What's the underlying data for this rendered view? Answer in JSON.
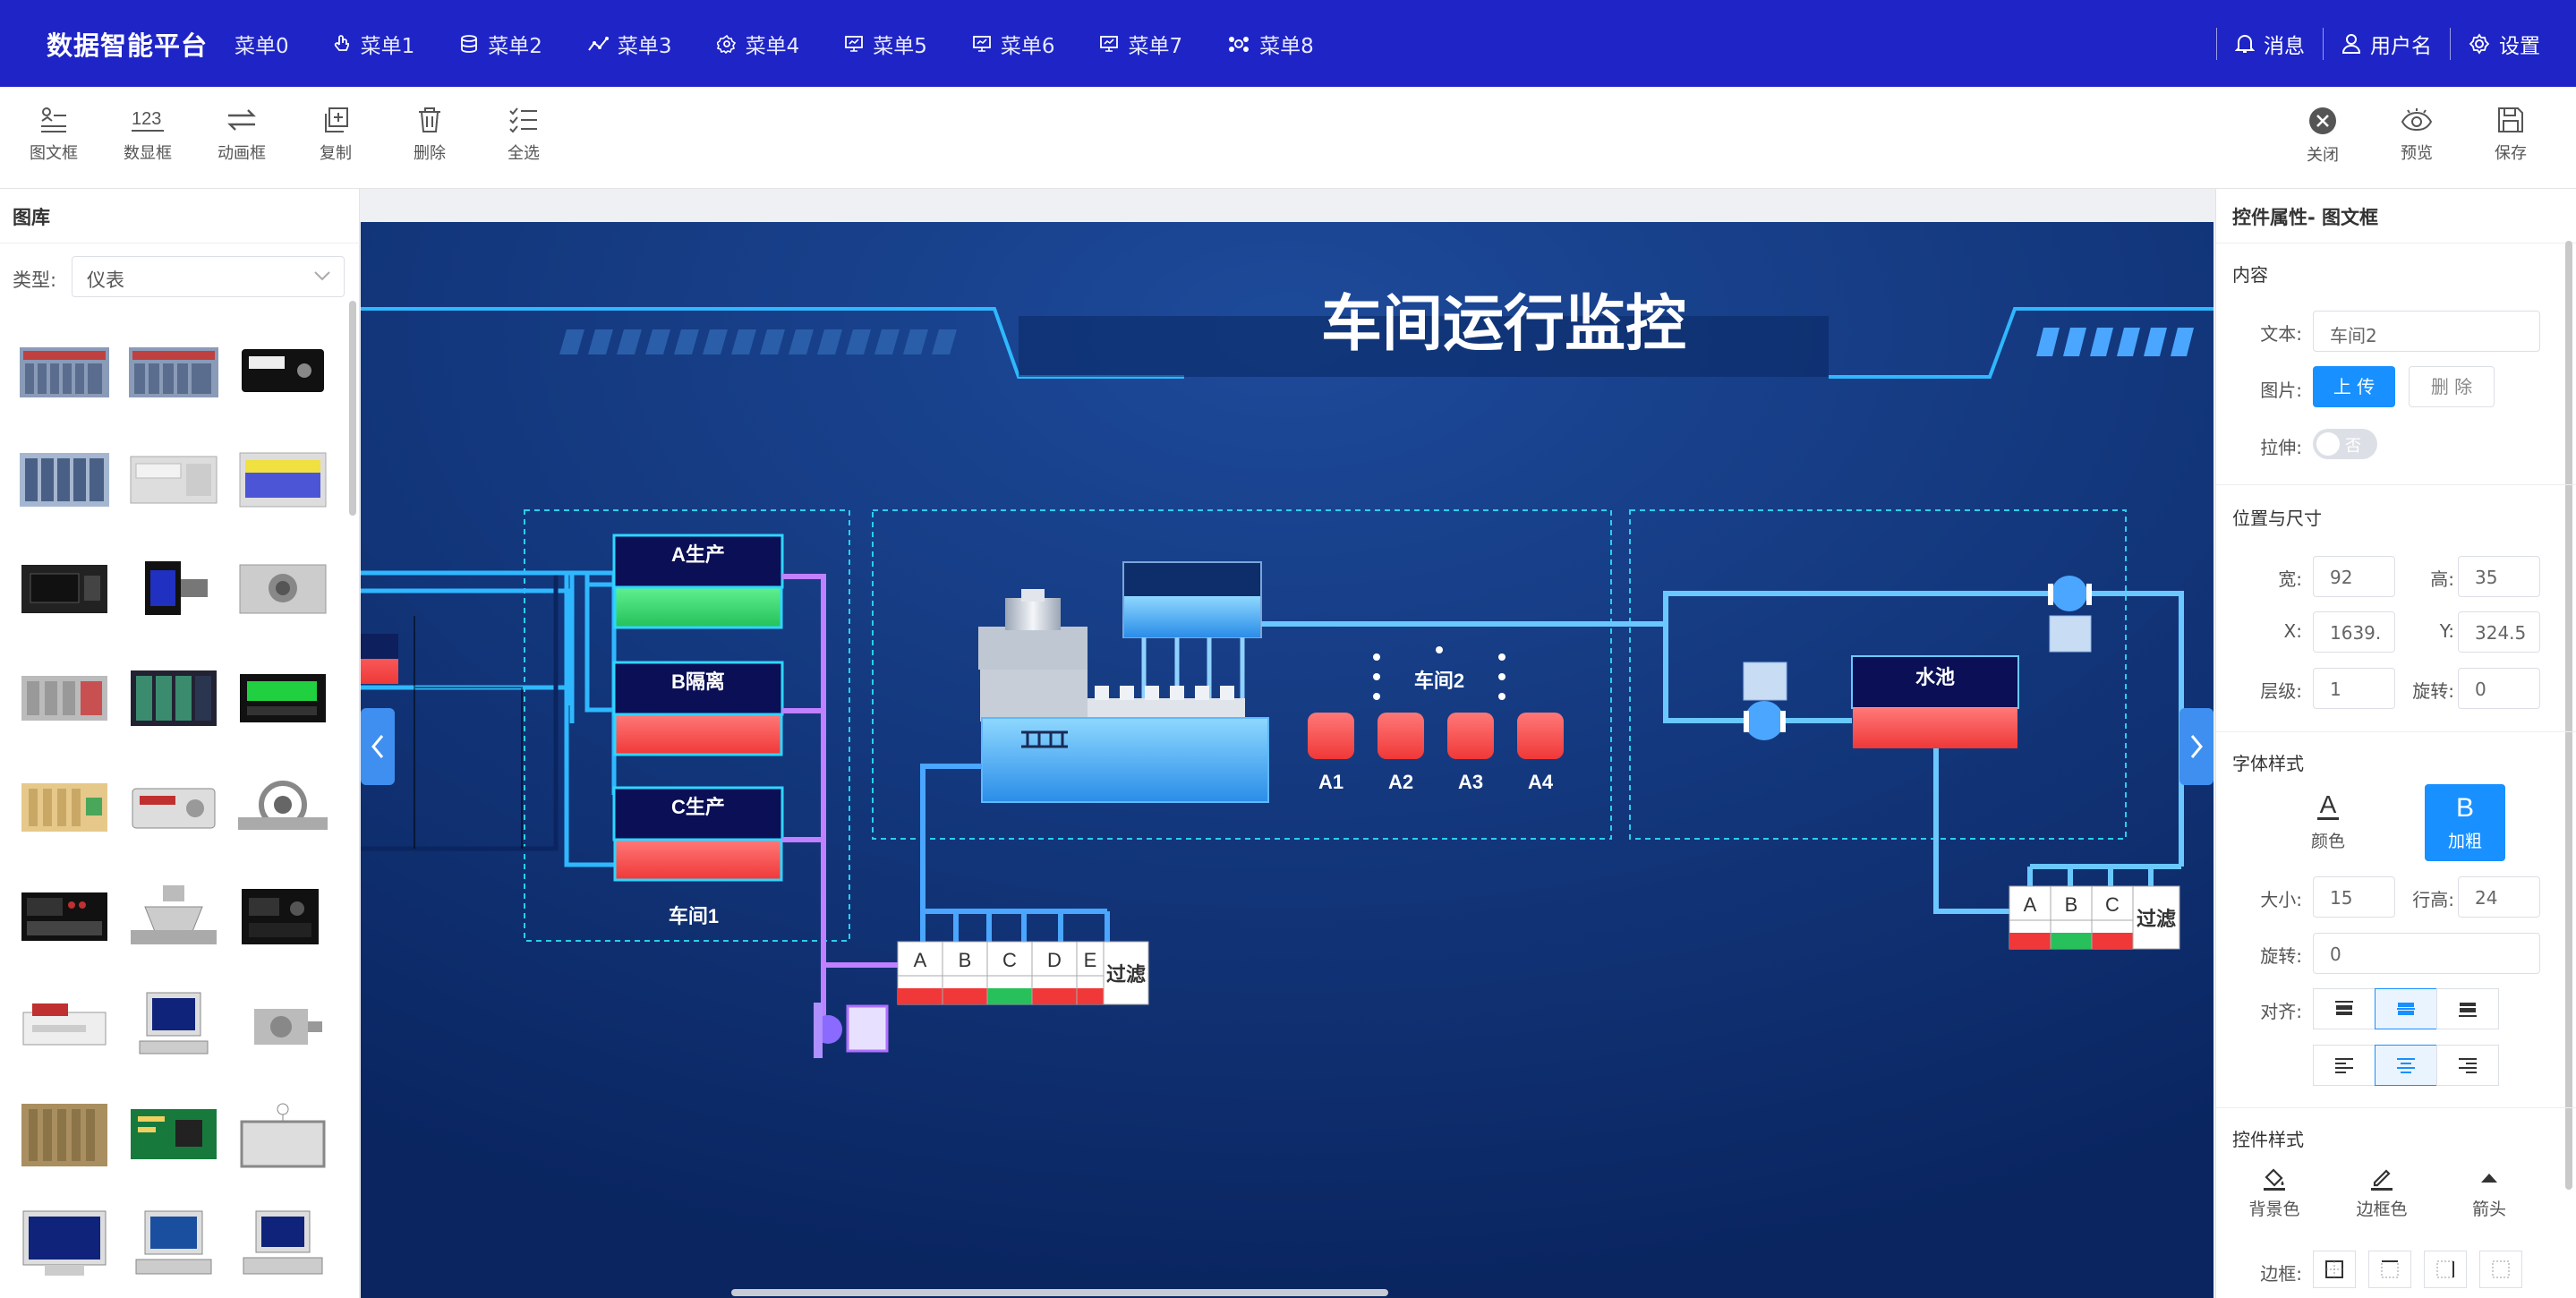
{
  "app": {
    "brand": "数据智能平台"
  },
  "menu": [
    "菜单0",
    "菜单1",
    "菜单2",
    "菜单3",
    "菜单4",
    "菜单5",
    "菜单6",
    "菜单7",
    "菜单8"
  ],
  "topright": {
    "messages": "消息",
    "username": "用户名",
    "settings": "设置"
  },
  "toolbar": {
    "left": [
      "图文框",
      "数显框",
      "动画框",
      "复制",
      "删除",
      "全选"
    ],
    "right": [
      "关闭",
      "预览",
      "保存"
    ]
  },
  "library": {
    "title": "图库",
    "type_label": "类型:",
    "type_value": "仪表"
  },
  "canvas": {
    "title": "车间运行监控",
    "box_a": "A生产",
    "box_b": "B隔离",
    "box_c": "C生产",
    "workshop1": "车间1",
    "workshop2": "车间2",
    "units": [
      "A1",
      "A2",
      "A3",
      "A4"
    ],
    "pool": "水池",
    "filter1_cols": [
      "A",
      "B",
      "C",
      "D",
      "E"
    ],
    "filter1_label": "过滤",
    "filter2_cols": [
      "A",
      "B",
      "C"
    ],
    "filter2_label": "过滤",
    "colors": {
      "bg": "#0d2e6a",
      "pipe": "#3aa3ff",
      "pipe_purple": "#b070ff",
      "alarm": "#ff4848",
      "ok": "#38d66c"
    }
  },
  "props": {
    "title": "控件属性- 图文框",
    "content_section": "内容",
    "text_label": "文本:",
    "text_value": "车间2",
    "image_label": "图片:",
    "upload": "上 传",
    "delete": "删 除",
    "stretch_label": "拉伸:",
    "stretch_value": "否",
    "pos_section": "位置与尺寸",
    "width_label": "宽:",
    "width_value": "92",
    "height_label": "高:",
    "height_value": "35",
    "x_label": "X:",
    "x_value": "1639.",
    "y_label": "Y:",
    "y_value": "324.5",
    "layer_label": "层级:",
    "layer_value": "1",
    "rotate_label": "旋转:",
    "rotate_value": "0",
    "font_section": "字体样式",
    "color_btn": "颜色",
    "bold_btn": "加粗",
    "size_label": "大小:",
    "size_value": "15",
    "lineheight_label": "行高:",
    "lineheight_value": "24",
    "frot_label": "旋转:",
    "frot_value": "0",
    "align_label": "对齐:",
    "style_section": "控件样式",
    "bg_color": "背景色",
    "border_color": "边框色",
    "arrow": "箭头",
    "border_label": "边框:"
  }
}
